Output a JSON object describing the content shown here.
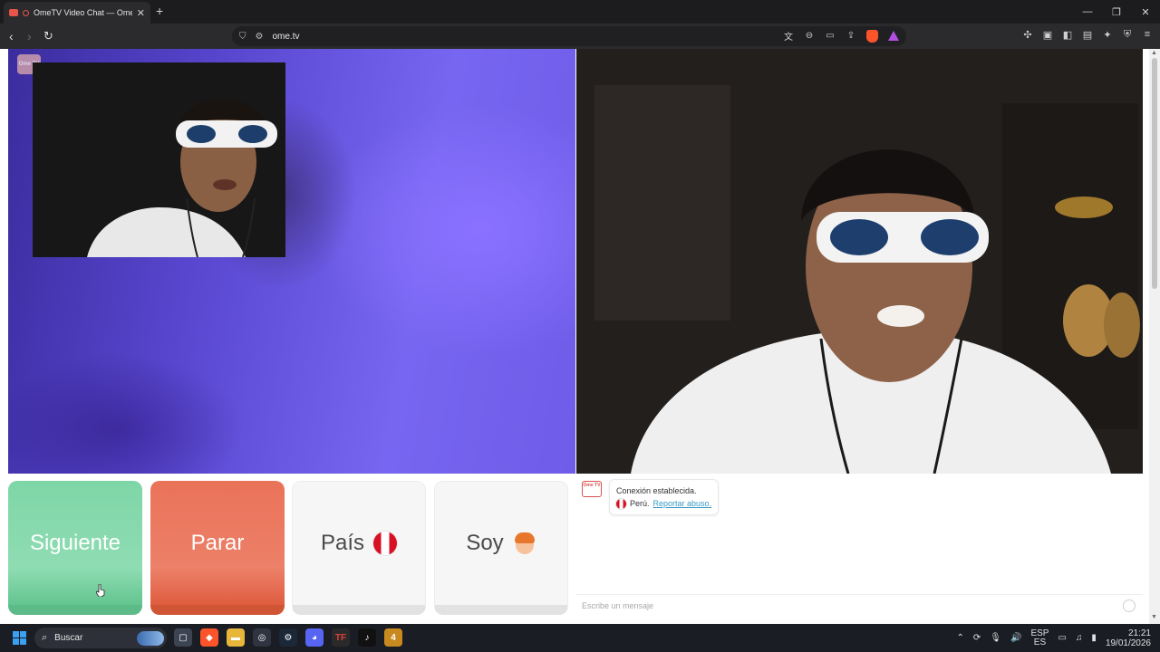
{
  "browser": {
    "tab_title": "OmeTV Video Chat — Omeg",
    "url": "ome.tv"
  },
  "app": {
    "logo_text": "Ome TV"
  },
  "buttons": {
    "next": "Siguiente",
    "stop": "Parar",
    "country": "País",
    "gender": "Soy"
  },
  "chat": {
    "status_message": "Conexión establecida.",
    "country_name": "Perú.",
    "report_link": "Reportar abuso.",
    "input_placeholder": "Escribe un mensaje"
  },
  "taskbar": {
    "search_label": "Buscar",
    "language_top": "ESP",
    "language_bottom": "ES",
    "time": "21:21",
    "date": "19/01/2026"
  },
  "colors": {
    "next_button": "#7ed6a7",
    "stop_button": "#ea7359",
    "flag_red": "#d91023",
    "link": "#3a9ac6"
  }
}
